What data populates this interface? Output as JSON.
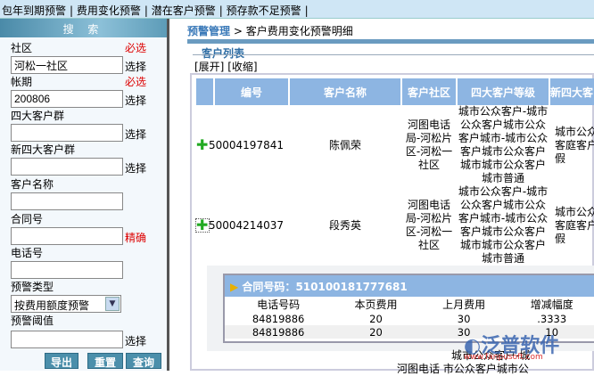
{
  "top_tabs": [
    "包年到期预警",
    "费用变化预警",
    "潜在客户预警",
    "预存款不足预警"
  ],
  "left": {
    "title": "搜 索",
    "fields": [
      {
        "label": "社区",
        "value": "河松一社区",
        "hint": "必选",
        "action": "选择"
      },
      {
        "label": "帐期",
        "value": "200806",
        "hint": "必选",
        "action": "选择"
      },
      {
        "label": "四大客户群",
        "value": "",
        "action": "选择"
      },
      {
        "label": "新四大客户群",
        "value": "",
        "action": "选择"
      },
      {
        "label": "客户名称",
        "value": ""
      },
      {
        "label": "合同号",
        "value": "",
        "hint": "精确"
      },
      {
        "label": "电话号",
        "value": ""
      },
      {
        "label": "预警类型",
        "value": "按费用额度预警"
      },
      {
        "label": "预警阈值",
        "value": "",
        "action": "选择"
      }
    ],
    "buttons": [
      "导出",
      "重置",
      "查询"
    ]
  },
  "breadcrumb": {
    "root": "预警管理",
    "sep": ">",
    "current": "客户费用变化预警明细"
  },
  "list": {
    "title": "客户列表",
    "expand": "[展开]",
    "collapse": "[收缩]",
    "columns": [
      "",
      "编号",
      "客户名称",
      "客户社区",
      "四大客户等级",
      "新四大客"
    ],
    "rows": [
      {
        "id": "50004197841",
        "name": "陈佩荣",
        "community": "河图电话局-河松片区-河松一社区",
        "level": "城市公众客户-城市公众客户城市公众客户城市-城市公众客户城市公众客户城市城市公众客户城市普通",
        "new_level": "城市公众客庭客户-假"
      },
      {
        "id": "50004214037",
        "name": "段秀英",
        "community": "河图电话局-河松片区-河松一社区",
        "level": "城市公众客户-城市公众客户城市公众客户城市-城市公众客户城市公众客户城市城市公众客户城市普通",
        "new_level": "城市公众客庭客户-假"
      }
    ],
    "next_row": {
      "level": "城市公众客户-城",
      "community": "河图电话 市公众客户城市公"
    }
  },
  "contract": {
    "label": "合同号码：",
    "number": "510100181777681",
    "columns": [
      "电话号码",
      "本页费用",
      "上月费用",
      "增减幅度"
    ],
    "rows": [
      [
        "84819886",
        "20",
        "30",
        ".3333"
      ],
      [
        "84819886",
        "20",
        "30",
        "10"
      ]
    ]
  },
  "watermark": {
    "brand": "泛普软件",
    "url": "www.fanpusoft.com"
  }
}
